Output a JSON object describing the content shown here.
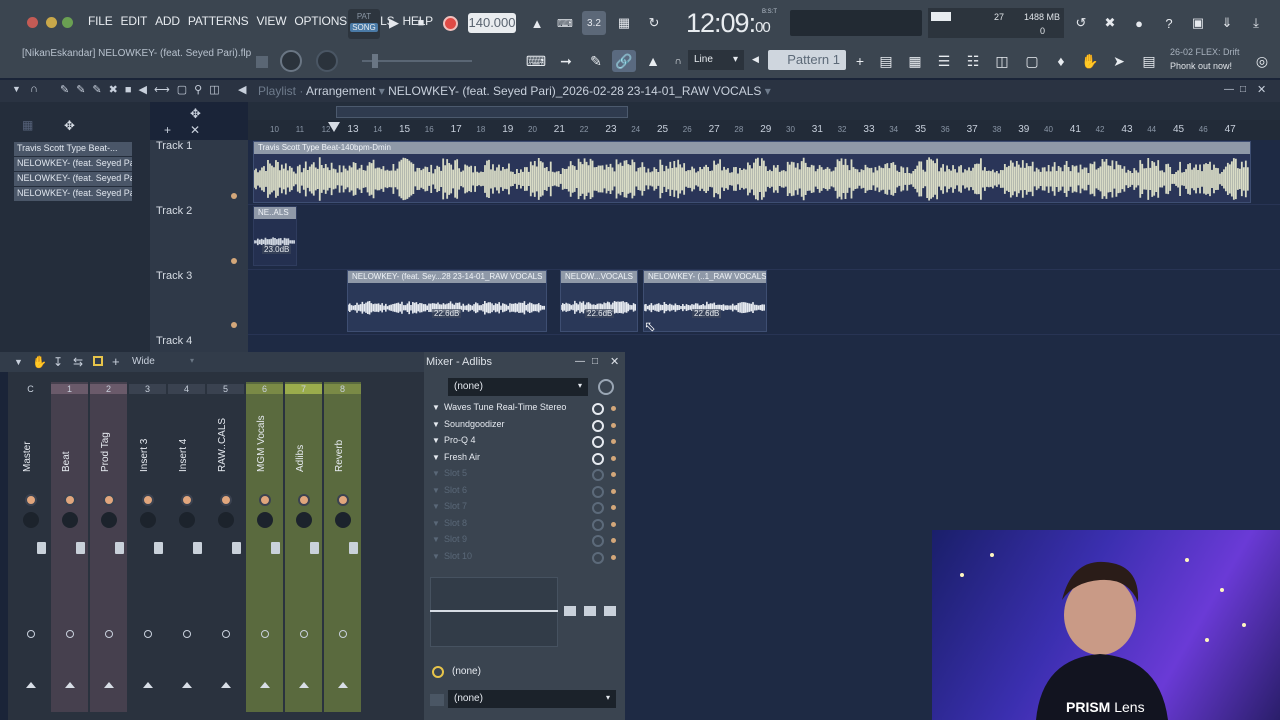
{
  "menu": [
    "FILE",
    "EDIT",
    "ADD",
    "PATTERNS",
    "VIEW",
    "OPTIONS",
    "TOOLS",
    "HELP"
  ],
  "mode": {
    "pat": "PAT",
    "song": "SONG"
  },
  "tempo": "140.000",
  "clock": {
    "main": "12:09",
    "sub": "00",
    "label": "B:S:T"
  },
  "cpu": {
    "value": "27",
    "memory": "1488 MB",
    "voices": "0"
  },
  "file_name": "[NikanEskandar] NELOWKEY- (feat. Seyed Pari).flp",
  "snap": "Line",
  "pattern": "Pattern 1",
  "news": {
    "date": "26-02",
    "title": "FLEX: Drift",
    "subtitle": "Phonk out now!"
  },
  "playlist": {
    "label": "Playlist",
    "crumb": "Arrangement",
    "title": "NELOWKEY- (feat. Seyed Pari)_2026-02-28 23-14-01_RAW VOCALS"
  },
  "ruler": [
    "10",
    "11",
    "12",
    "13",
    "14",
    "15",
    "16",
    "17",
    "18",
    "19",
    "20",
    "21",
    "22",
    "23",
    "24",
    "25",
    "26",
    "27",
    "28",
    "29",
    "30",
    "31",
    "32",
    "33",
    "34",
    "35",
    "36",
    "37",
    "38",
    "39",
    "40",
    "41",
    "42",
    "43",
    "44",
    "45",
    "46",
    "47"
  ],
  "picker": [
    "Travis Scott Type Beat-...",
    "NELOWKEY- (feat. Seyed Pari...",
    "NELOWKEY- (feat. Seyed Pari...",
    "NELOWKEY- (feat. Seyed Pari..."
  ],
  "tracks": [
    "Track 1",
    "Track 2",
    "Track 3",
    "Track 4"
  ],
  "clips": {
    "c1": "Travis Scott Type Beat-140bpm-Dmin",
    "c2": "NE..ALS",
    "c2db": "23.0dB",
    "c3": "NELOWKEY- (feat. Sey...28 23-14-01_RAW VOCALS",
    "c3db": "22.6dB",
    "c4": "NELOW...VOCALS",
    "c4db": "22.6dB",
    "c5": "NELOWKEY- (..1_RAW VOCALS",
    "c5db": "22.6dB"
  },
  "mixer": {
    "view": "Wide",
    "title": "Mixer - Adlibs",
    "strips": [
      {
        "num": "C",
        "name": "Master"
      },
      {
        "num": "1",
        "name": "Beat"
      },
      {
        "num": "2",
        "name": "Prod Tag"
      },
      {
        "num": "3",
        "name": "Insert 3"
      },
      {
        "num": "4",
        "name": "Insert 4"
      },
      {
        "num": "5",
        "name": "RAW..CALS"
      },
      {
        "num": "6",
        "name": "MGM Vocals"
      },
      {
        "num": "7",
        "name": "Adlibs"
      },
      {
        "num": "8",
        "name": "Reverb"
      }
    ],
    "input": "(none)",
    "fx": [
      "Waves Tune Real-Time Stereo",
      "Soundgoodizer",
      "Pro-Q 4",
      "Fresh Air",
      "Slot 5",
      "Slot 6",
      "Slot 7",
      "Slot 8",
      "Slot 9",
      "Slot 10"
    ],
    "eq_preset": "(none)",
    "output": "(none)"
  },
  "webcam": {
    "brand": "PRISM",
    "product": "Lens"
  }
}
